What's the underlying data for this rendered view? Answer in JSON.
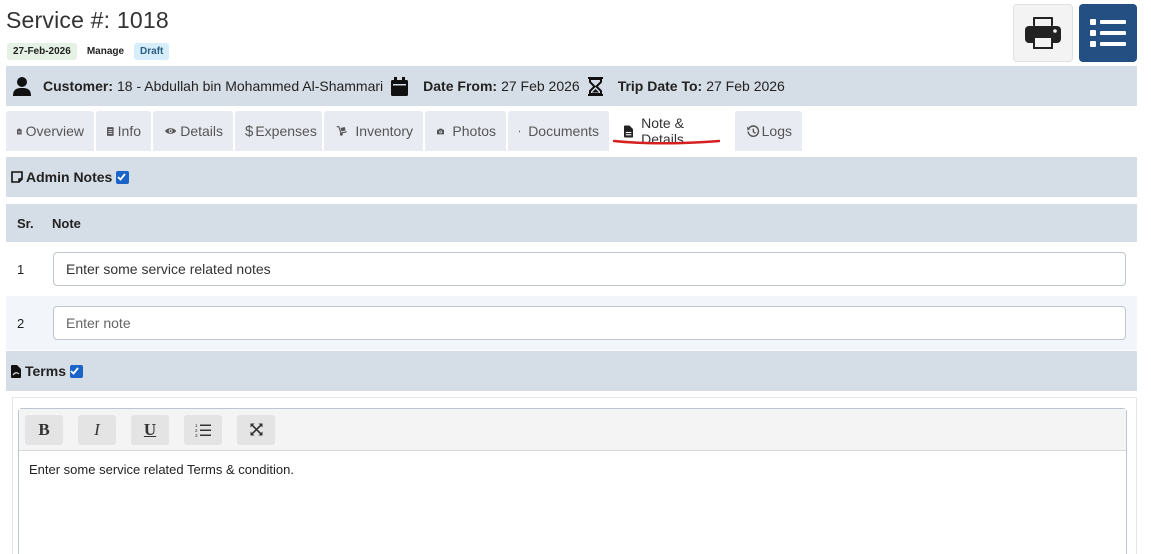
{
  "header": {
    "title": "Service #: 1018",
    "badges": {
      "date": "27-Feb-2026",
      "manage": "Manage",
      "status": "Draft"
    }
  },
  "icons": {
    "print": "print-icon",
    "menu": "list-icon"
  },
  "info": {
    "customer_label": "Customer:",
    "customer_value": "18 - Abdullah bin Mohammed Al-Shammari",
    "date_from_label": "Date From:",
    "date_from_value": "27 Feb 2026",
    "trip_date_label": "Trip Date To:",
    "trip_date_value": "27 Feb 2026"
  },
  "tabs": [
    {
      "label": "Overview"
    },
    {
      "label": "Info"
    },
    {
      "label": "Details"
    },
    {
      "label": "Expenses"
    },
    {
      "label": "Inventory"
    },
    {
      "label": "Photos"
    },
    {
      "label": "Documents"
    },
    {
      "label": "Note & Details",
      "active": true
    },
    {
      "label": "Logs"
    }
  ],
  "admin_notes": {
    "title": "Admin Notes",
    "columns": {
      "sr": "Sr.",
      "note": "Note"
    },
    "rows": [
      {
        "sr": "1",
        "value": "Enter some service related notes",
        "placeholder": "Enter note"
      },
      {
        "sr": "2",
        "value": "",
        "placeholder": "Enter note"
      }
    ]
  },
  "terms": {
    "title": "Terms",
    "toolbar": {
      "bold": "B",
      "italic": "I",
      "underline": "U"
    },
    "content": "Enter some service related Terms & condition."
  },
  "colors": {
    "primary": "#234f82",
    "bar": "#d5dde7",
    "underline": "#d42020",
    "checkbox": "#1a63c8"
  }
}
